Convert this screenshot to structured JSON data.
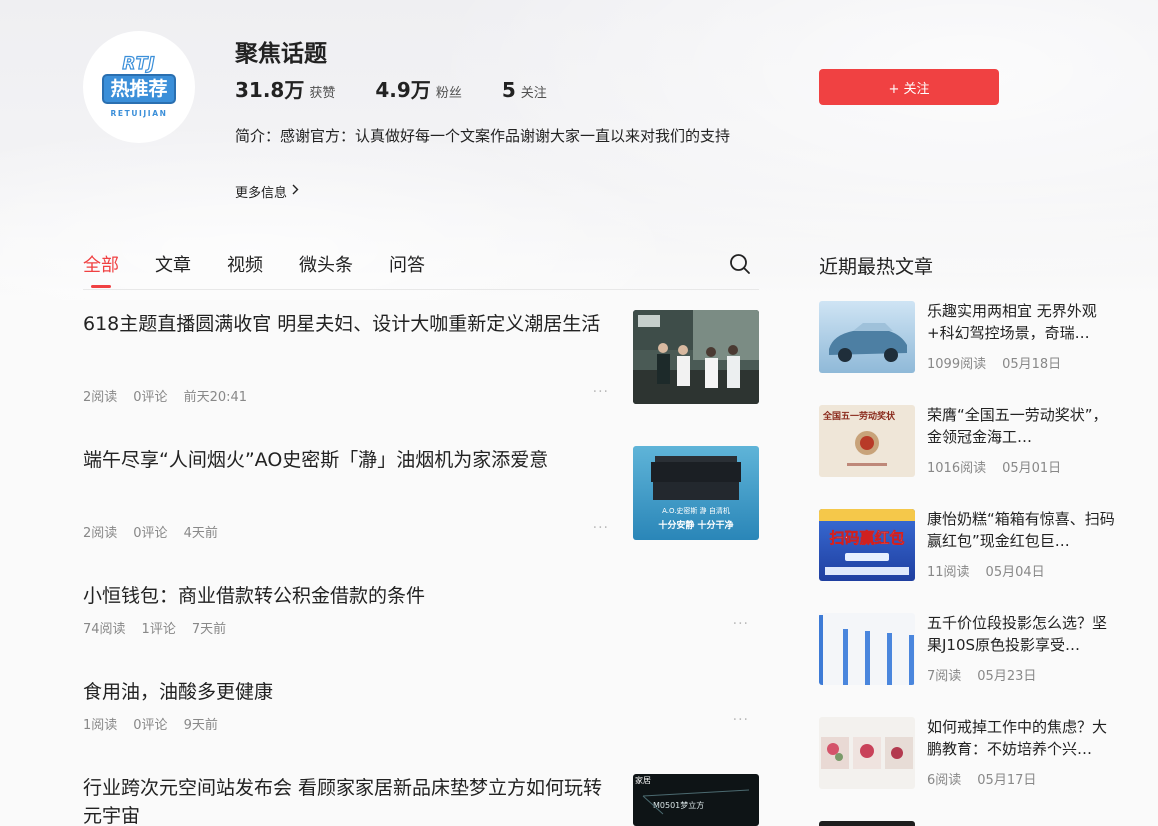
{
  "profile": {
    "name": "聚焦话题",
    "avatar": {
      "top": "RTJ",
      "mid": "热推荐",
      "bottom": "RETUIJIAN"
    },
    "stats": [
      {
        "value": "31.8万",
        "label": "获赞"
      },
      {
        "value": "4.9万",
        "label": "粉丝"
      },
      {
        "value": "5",
        "label": "关注"
      }
    ],
    "intro": "简介：感谢官方：认真做好每一个文案作品谢谢大家一直以来对我们的支持",
    "more_info": "更多信息",
    "follow_label": "+ 关注"
  },
  "tabs": [
    "全部",
    "文章",
    "视频",
    "微头条",
    "问答"
  ],
  "feed": [
    {
      "title": "618主题直播圆满收官 明星夫妇、设计大咖重新定义潮居生活",
      "reads": "2阅读",
      "comments": "0评论",
      "time": "前天20:41"
    },
    {
      "title": "端午尽享“人间烟火”AO史密斯「瀞」油烟机为家添爱意",
      "reads": "2阅读",
      "comments": "0评论",
      "time": "4天前"
    },
    {
      "title": "小恒钱包：商业借款转公积金借款的条件",
      "reads": "74阅读",
      "comments": "1评论",
      "time": "7天前"
    },
    {
      "title": "食用油，油酸多更健康",
      "reads": "1阅读",
      "comments": "0评论",
      "time": "9天前"
    },
    {
      "title": "行业跨次元空间站发布会 看顾家家居新品床垫梦立方如何玩转元宇宙",
      "reads": "",
      "comments": "",
      "time": ""
    }
  ],
  "feed_thumbs": {
    "item2_line1": "A.O.史密斯  瀞 自清机",
    "item2_line2": "十分安静  十分干净",
    "item5_tag": "家居",
    "item5_text": "M0501梦立方"
  },
  "sidebar": {
    "title": "近期最热文章",
    "items": [
      {
        "title": "乐趣实用两相宜 无界外观+科幻驾控场景，奇瑞…",
        "reads": "1099阅读",
        "date": "05月18日"
      },
      {
        "title": "荣膺“全国五一劳动奖状”，金领冠金海工…",
        "reads": "1016阅读",
        "date": "05月01日",
        "thumb_text": "全国五一劳动奖状"
      },
      {
        "title": "康怡奶糕“箱箱有惊喜、扫码赢红包”现金红包巨…",
        "reads": "11阅读",
        "date": "05月04日",
        "thumb_text": "扫码赢红包"
      },
      {
        "title": "五千价位段投影怎么选？坚果J10S原色投影享受…",
        "reads": "7阅读",
        "date": "05月23日"
      },
      {
        "title": "如何戒掉工作中的焦虑？大鹏教育：不妨培养个兴…",
        "reads": "6阅读",
        "date": "05月17日"
      }
    ]
  },
  "colors": {
    "accent": "#f04142",
    "avatar_blue": "#3b8fd9"
  },
  "icons": {
    "search": "search-icon",
    "more": "more-dots-icon",
    "chevron": "chevron-right-icon"
  }
}
